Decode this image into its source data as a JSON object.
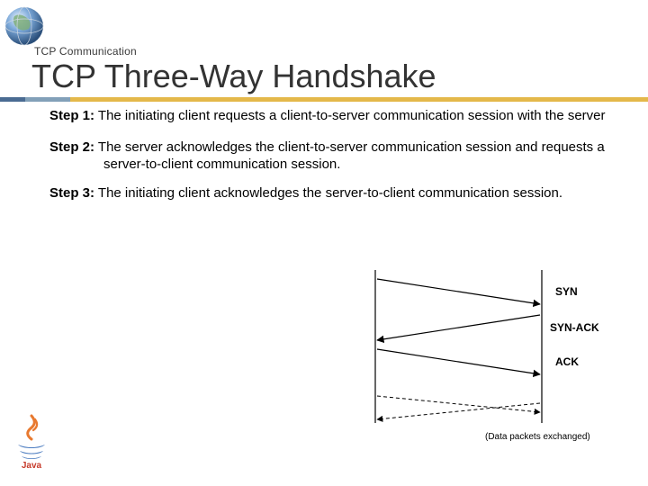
{
  "breadcrumb": "TCP Communication",
  "title": "TCP Three-Way Handshake",
  "steps": [
    {
      "label": "Step 1:",
      "text": "The initiating client requests a client-to-server communication session with the server"
    },
    {
      "label": "Step 2:",
      "text": "The server acknowledges the client-to-server communication session and requests a server-to-client communication session."
    },
    {
      "label": "Step 3:",
      "text": "The initiating client acknowledges the server-to-client communication session."
    }
  ],
  "diagram": {
    "arrow1": "SYN",
    "arrow2": "SYN-ACK",
    "arrow3": "ACK",
    "footer": "(Data packets exchanged)"
  },
  "logos": {
    "globe": "globe-icon",
    "java": "java-icon"
  }
}
